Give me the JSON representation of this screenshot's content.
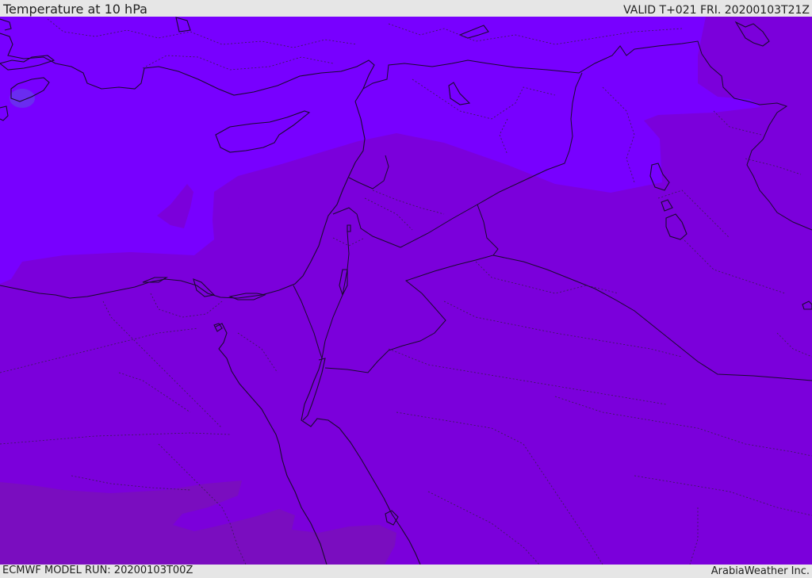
{
  "header": {
    "title": "Temperature at 10 hPa",
    "valid_time": "VALID T+021 FRI. 20200103T21Z"
  },
  "footer": {
    "model_run": "ECMWF MODEL RUN: 20200103T00Z",
    "credit": "ArabiaWeather Inc."
  },
  "colors": {
    "field_cool": "#7800ff",
    "field_mid": "#7b00db",
    "field_warm": "#7a0dbf",
    "field_spot": "#6a2cf0",
    "lines": "#1a0a2e"
  }
}
